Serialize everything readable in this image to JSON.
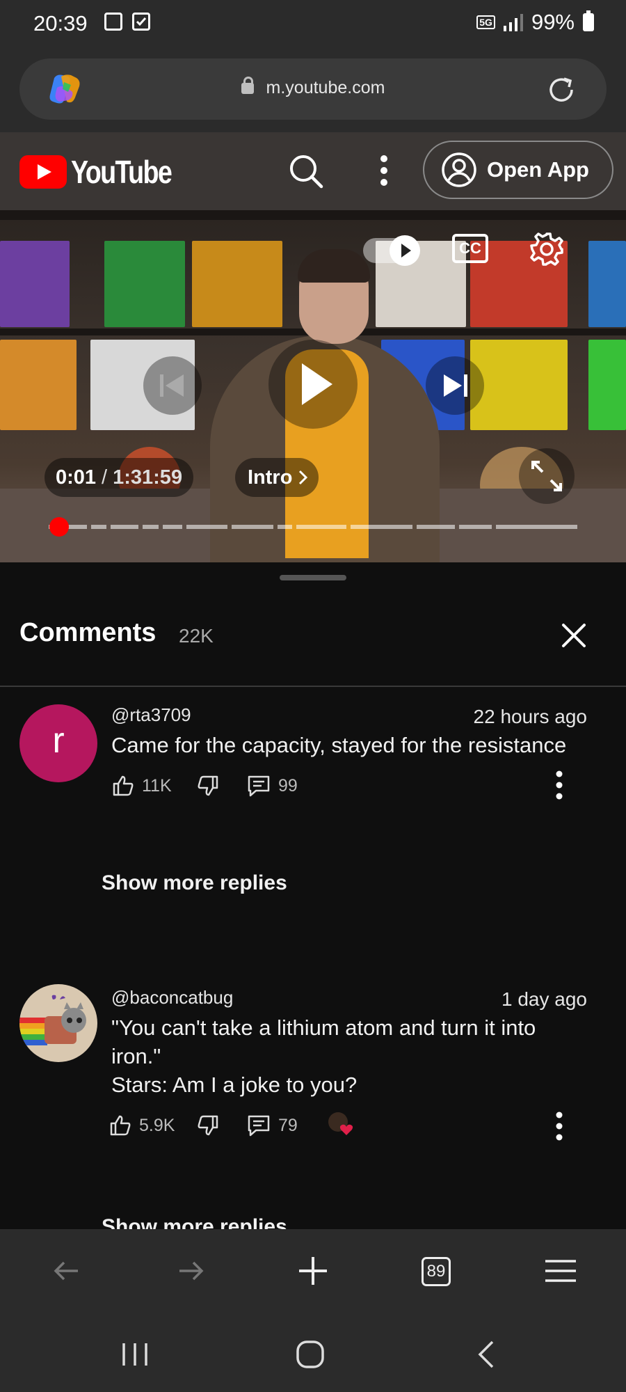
{
  "status_bar": {
    "time": "20:39",
    "network": "5G",
    "battery": "99%"
  },
  "browser": {
    "url": "m.youtube.com",
    "tab_count": "89"
  },
  "header": {
    "logo_text": "YouTube",
    "open_app_label": "Open App"
  },
  "player": {
    "time_current": "0:01",
    "time_separator": "/",
    "time_total": "1:31:59",
    "chapter_label": "Intro",
    "cc_label": "CC",
    "progress": 0.0
  },
  "comments": {
    "title": "Comments",
    "count": "22K",
    "items": [
      {
        "avatar_letter": "r",
        "avatar_color": "#b5175e",
        "handle": "@rta3709",
        "time": "22 hours ago",
        "text": "Came for the capacity, stayed for the resistance",
        "likes": "11K",
        "replies": "99",
        "more_replies_label": "Show more replies"
      },
      {
        "avatar_letter": "",
        "avatar_color": "#d9c8b0",
        "handle": "@baconcatbug",
        "time": "1 day ago",
        "text_line1": "\"You can't take a lithium atom and turn it into",
        "text_line2": "iron.\"",
        "text_line3": "Stars: Am I a joke to you?",
        "likes": "5.9K",
        "replies": "79",
        "more_replies_label": "Show more replies"
      }
    ]
  },
  "colors": {
    "brand_red": "#ff0000",
    "background": "#0f0f0f",
    "bar": "#2b2b2b"
  }
}
